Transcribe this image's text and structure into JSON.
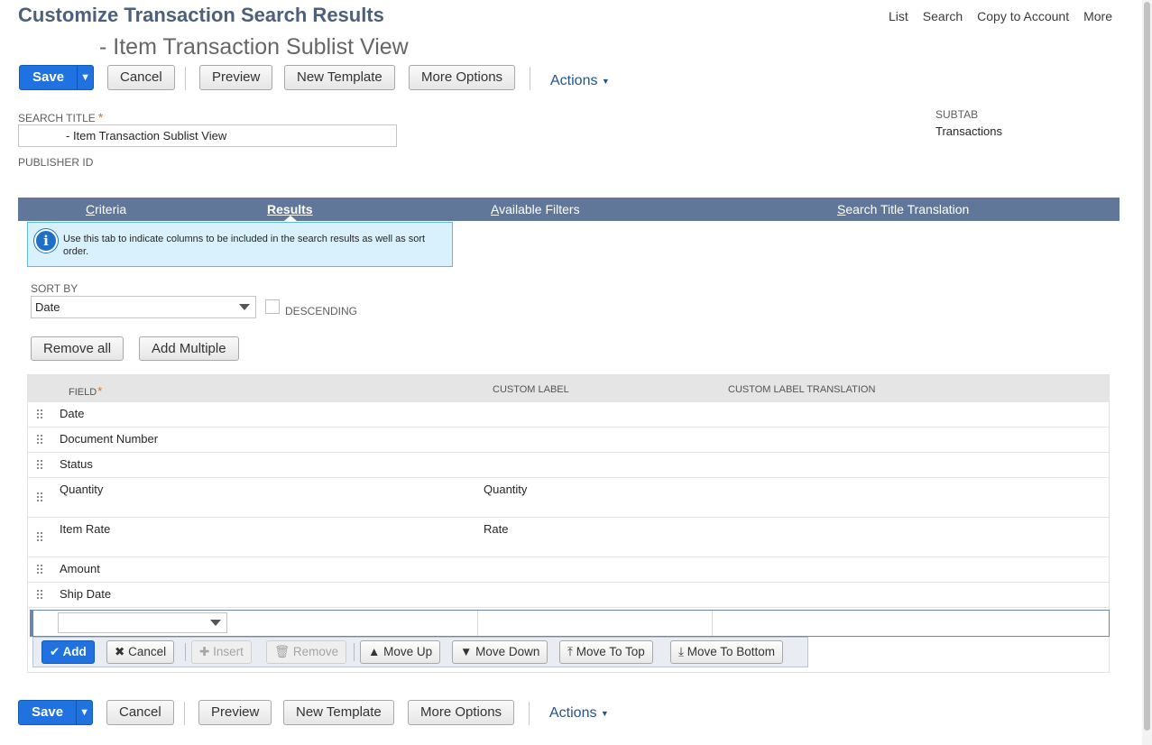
{
  "header": {
    "title": "Customize Transaction Search Results",
    "subtitle": "- Item Transaction Sublist View",
    "links": [
      "List",
      "Search",
      "Copy to Account",
      "More"
    ]
  },
  "buttons": {
    "save": "Save",
    "cancel": "Cancel",
    "preview": "Preview",
    "new_template": "New Template",
    "more_options": "More Options",
    "actions": "Actions"
  },
  "form": {
    "search_title_label": "SEARCH TITLE",
    "search_title_value": "- Item Transaction Sublist View",
    "publisher_id_label": "PUBLISHER ID",
    "subtab_label": "SUBTAB",
    "subtab_value": "Transactions",
    "required_mark": "*"
  },
  "tabs": [
    {
      "first": "C",
      "rest": "riteria"
    },
    {
      "first": "R",
      "rest": "esults"
    },
    {
      "first": "A",
      "rest": "vailable Filters"
    },
    {
      "first": "S",
      "rest": "earch Title Translation"
    }
  ],
  "active_tab": "Results",
  "info": {
    "icon": "info-icon",
    "text": "Use this tab to indicate columns to be included in the search results as well as sort order."
  },
  "sort": {
    "label": "SORT BY",
    "value": "Date",
    "descending_label": "DESCENDING",
    "descending_checked": false
  },
  "list_buttons": {
    "remove_all": "Remove all",
    "add_multiple": "Add Multiple"
  },
  "table": {
    "columns": [
      "FIELD",
      "CUSTOM LABEL",
      "CUSTOM LABEL TRANSLATION"
    ],
    "rows": [
      {
        "field": "Date",
        "custom_label": "",
        "translation": ""
      },
      {
        "field": "Document Number",
        "custom_label": "",
        "translation": ""
      },
      {
        "field": "Status",
        "custom_label": "",
        "translation": ""
      },
      {
        "field": "Quantity",
        "custom_label": "Quantity",
        "translation": ""
      },
      {
        "field": "Item Rate",
        "custom_label": "Rate",
        "translation": ""
      },
      {
        "field": "Amount",
        "custom_label": "",
        "translation": ""
      },
      {
        "field": "Ship Date",
        "custom_label": "",
        "translation": ""
      }
    ]
  },
  "row_toolbar": {
    "add": "Add",
    "cancel": "Cancel",
    "insert": "Insert",
    "remove": "Remove",
    "move_up": "Move Up",
    "move_down": "Move Down",
    "move_to_top": "Move To Top",
    "move_to_bottom": "Move To Bottom"
  },
  "colors": {
    "primary": "#1f72e0",
    "tabbar": "#607799",
    "title": "#4d5f79",
    "info_bg": "#d9f1fc"
  }
}
